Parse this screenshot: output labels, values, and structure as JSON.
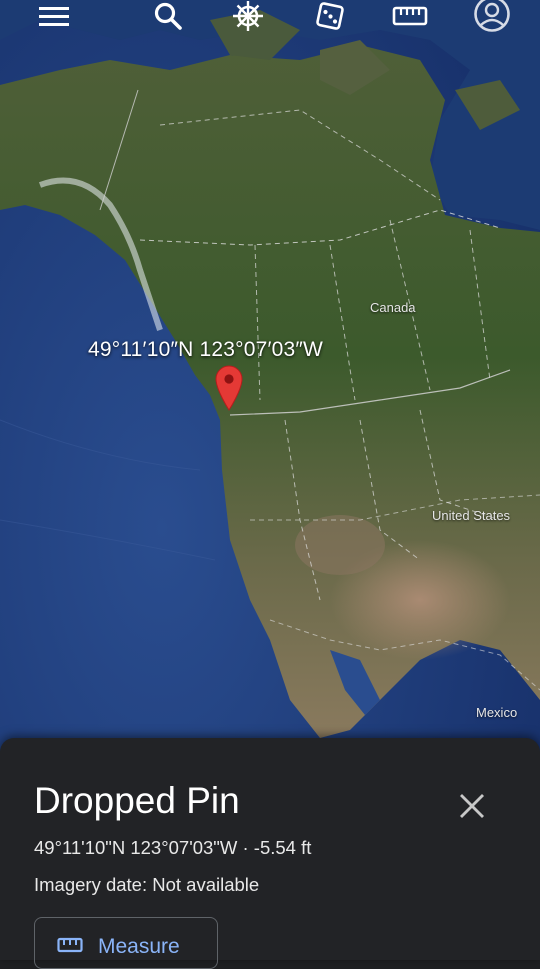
{
  "toolbar": {
    "icons": [
      "menu-icon",
      "search-icon",
      "voyager-wheel-icon",
      "dice-icon",
      "ruler-icon",
      "account-icon"
    ]
  },
  "map": {
    "place_labels": {
      "canada": "Canada",
      "united_states": "United States",
      "mexico": "Mexico"
    },
    "pin_coordinates_label": "49°11′10″N 123°07′03″W",
    "colors": {
      "ocean": "#1f3d7a",
      "land": "#3d5a2a",
      "pin": "#e53935"
    }
  },
  "sheet": {
    "title": "Dropped Pin",
    "coordinates": "49°11'10\"N 123°07'03\"W · -5.54 ft",
    "imagery_date": "Imagery date: Not available",
    "measure_label": "Measure",
    "close_icon": "close-icon",
    "colors": {
      "background": "#222326",
      "accent": "#8ab4f8"
    }
  }
}
